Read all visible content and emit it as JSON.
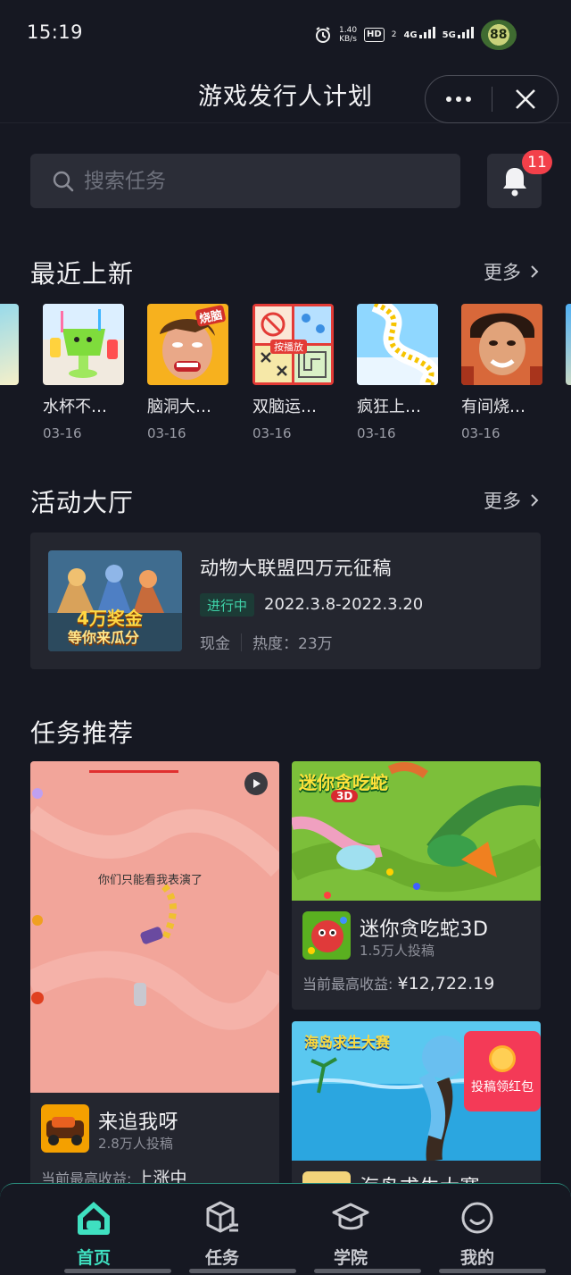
{
  "status_bar": {
    "time": "15:19",
    "net_speed_value": "1.40",
    "net_speed_unit": "KB/s",
    "hd_label": "HD",
    "hd_sub": "2",
    "sim1": "4G",
    "sim2": "5G",
    "battery": "88"
  },
  "header": {
    "title": "游戏发行人计划",
    "more_icon": "more-dots-icon",
    "close_icon": "close-icon"
  },
  "search": {
    "placeholder": "搜索任务",
    "notification_count": "11"
  },
  "recent": {
    "title": "最近上新",
    "more_label": "更多",
    "items": [
      {
        "name": "水杯不…",
        "date": "03-16"
      },
      {
        "name": "脑洞大…",
        "date": "03-16"
      },
      {
        "name": "双脑运…",
        "date": "03-16"
      },
      {
        "name": "疯狂上…",
        "date": "03-16"
      },
      {
        "name": "有间烧…",
        "date": "03-16"
      }
    ],
    "thumb_texts": {
      "burn": "烧脑",
      "play": "按播放"
    }
  },
  "activity": {
    "title": "活动大厅",
    "more_label": "更多",
    "card": {
      "title": "动物大联盟四万元征稿",
      "status": "进行中",
      "date_range": "2022.3.8-2022.3.20",
      "reward_type": "现金",
      "heat": "热度：23万",
      "banner_line1": "4万奖金",
      "banner_line2": "等你来瓜分"
    }
  },
  "tasks": {
    "title": "任务推荐",
    "items": [
      {
        "name": "来追我呀",
        "count": "2.8万人投稿",
        "earn_label": "当前最高收益:",
        "earn_value": "上涨中",
        "video_caption": "你们只能看我表演了"
      },
      {
        "name": "迷你贪吃蛇3D",
        "count": "1.5万人投稿",
        "earn_label": "当前最高收益:",
        "earn_value": "¥12,722.19",
        "banner_title": "迷你贪吃蛇",
        "banner_sub": "3D"
      },
      {
        "name": "海岛求生大赛",
        "banner_title": "海岛求生大赛",
        "redpack_label": "投稿领红包"
      }
    ]
  },
  "nav": {
    "items": [
      {
        "label": "首页",
        "icon": "home-icon"
      },
      {
        "label": "任务",
        "icon": "task-box-icon"
      },
      {
        "label": "学院",
        "icon": "graduation-cap-icon"
      },
      {
        "label": "我的",
        "icon": "smile-profile-icon"
      }
    ],
    "active_color": "#3fe0c0"
  }
}
